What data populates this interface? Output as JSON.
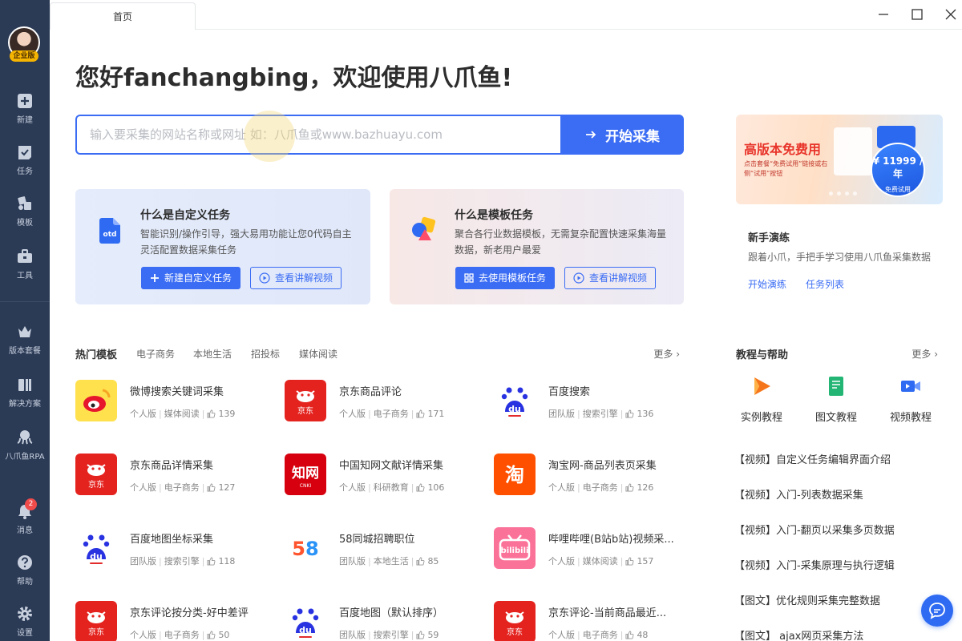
{
  "window": {
    "tab_label": "首页"
  },
  "sidebar": {
    "edition_badge": "企业版",
    "items": [
      {
        "label": "新建",
        "icon": "plus-square-icon"
      },
      {
        "label": "任务",
        "icon": "task-check-icon"
      },
      {
        "label": "模板",
        "icon": "template-icon"
      },
      {
        "label": "工具",
        "icon": "toolbox-icon"
      },
      {
        "label": "版本套餐",
        "icon": "crown-icon"
      },
      {
        "label": "解决方案",
        "icon": "solution-icon"
      },
      {
        "label": "八爪鱼RPA",
        "icon": "octopus-icon"
      },
      {
        "label": "消息",
        "icon": "bell-icon",
        "badge": "2"
      },
      {
        "label": "帮助",
        "icon": "help-icon"
      },
      {
        "label": "设置",
        "icon": "gear-icon"
      }
    ]
  },
  "greeting": "您好fanchangbing，欢迎使用八爪鱼!",
  "search": {
    "placeholder": "输入要采集的网站名称或网址 如：八爪鱼或www.bazhuayu.com",
    "button_label": "开始采集"
  },
  "cards": {
    "custom": {
      "title": "什么是自定义任务",
      "desc": "智能识别/操作引导，强大易用功能让您0代码自主灵活配置数据采集任务",
      "icon_text": "otd",
      "primary_label": "新建自定义任务",
      "video_label": "查看讲解视频"
    },
    "template": {
      "title": "什么是模板任务",
      "desc": "聚合各行业数据模板，无需复杂配置快速采集海量数据，新老用户最爱",
      "primary_label": "去使用模板任务",
      "video_label": "查看讲解视频"
    }
  },
  "hot": {
    "title": "热门模板",
    "categories": [
      "电子商务",
      "本地生活",
      "招投标",
      "媒体阅读"
    ],
    "more": "更多",
    "templates": [
      {
        "name": "微博搜索关键词采集",
        "edition": "个人版",
        "category": "媒体阅读",
        "likes": "139",
        "logo": "weibo"
      },
      {
        "name": "京东商品评论",
        "edition": "个人版",
        "category": "电子商务",
        "likes": "171",
        "logo": "jd"
      },
      {
        "name": "百度搜索",
        "edition": "团队版",
        "category": "搜索引擎",
        "likes": "136",
        "logo": "baidu"
      },
      {
        "name": "京东商品详情采集",
        "edition": "个人版",
        "category": "电子商务",
        "likes": "127",
        "logo": "jd"
      },
      {
        "name": "中国知网文献详情采集",
        "edition": "个人版",
        "category": "科研教育",
        "likes": "106",
        "logo": "cnki"
      },
      {
        "name": "淘宝网-商品列表页采集",
        "edition": "个人版",
        "category": "电子商务",
        "likes": "126",
        "logo": "taobao"
      },
      {
        "name": "百度地图坐标采集",
        "edition": "团队版",
        "category": "搜索引擎",
        "likes": "118",
        "logo": "baidu"
      },
      {
        "name": "58同城招聘职位",
        "edition": "团队版",
        "category": "本地生活",
        "likes": "85",
        "logo": "58"
      },
      {
        "name": "哔哩哔哩(B站b站)视频采...",
        "edition": "个人版",
        "category": "媒体阅读",
        "likes": "157",
        "logo": "bilibili"
      },
      {
        "name": "京东评论按分类-好中差评",
        "edition": "个人版",
        "category": "电子商务",
        "likes": "50",
        "logo": "jd"
      },
      {
        "name": "百度地图（默认排序）",
        "edition": "团队版",
        "category": "搜索引擎",
        "likes": "59",
        "logo": "baidu"
      },
      {
        "name": "京东评论-当前商品最近...",
        "edition": "个人版",
        "category": "电子商务",
        "likes": "48",
        "logo": "jd"
      }
    ]
  },
  "logo_text": {
    "jd": "京东",
    "cnki": "知网",
    "cnki_sub": "CNKI",
    "taobao": "淘",
    "baidu": "du",
    "bilibili": "bilibili",
    "n58": "58"
  },
  "banner": {
    "title": "高版本免费用",
    "subtitle": "点击套餐“免费试用”链接或右侧“试用”按钮",
    "price": "¥ 11999 /年",
    "cta": "免费试用"
  },
  "guide": {
    "title": "新手演练",
    "desc": "跟着小爪，手把手学习使用八爪鱼采集数据",
    "start_label": "开始演练",
    "tasks_label": "任务列表"
  },
  "help": {
    "title": "教程与帮助",
    "more": "更多",
    "categories": [
      {
        "label": "实例教程",
        "icon": "play-icon",
        "color": "#f5761a"
      },
      {
        "label": "图文教程",
        "icon": "document-icon",
        "color": "#22b573"
      },
      {
        "label": "视频教程",
        "icon": "video-camera-icon",
        "color": "#2f6bf2"
      }
    ],
    "items": [
      "【视频】自定义任务编辑界面介绍",
      "【视频】入门-列表数据采集",
      "【视频】入门-翻页以采集多页数据",
      "【视频】入门-采集原理与执行逻辑",
      "【图文】优化规则采集完整数据",
      "【图文】 ajax网页采集方法"
    ]
  },
  "colors": {
    "accent": "#3a6cf4",
    "sidebar": "#2b3a55",
    "badge": "#f04b4b"
  }
}
